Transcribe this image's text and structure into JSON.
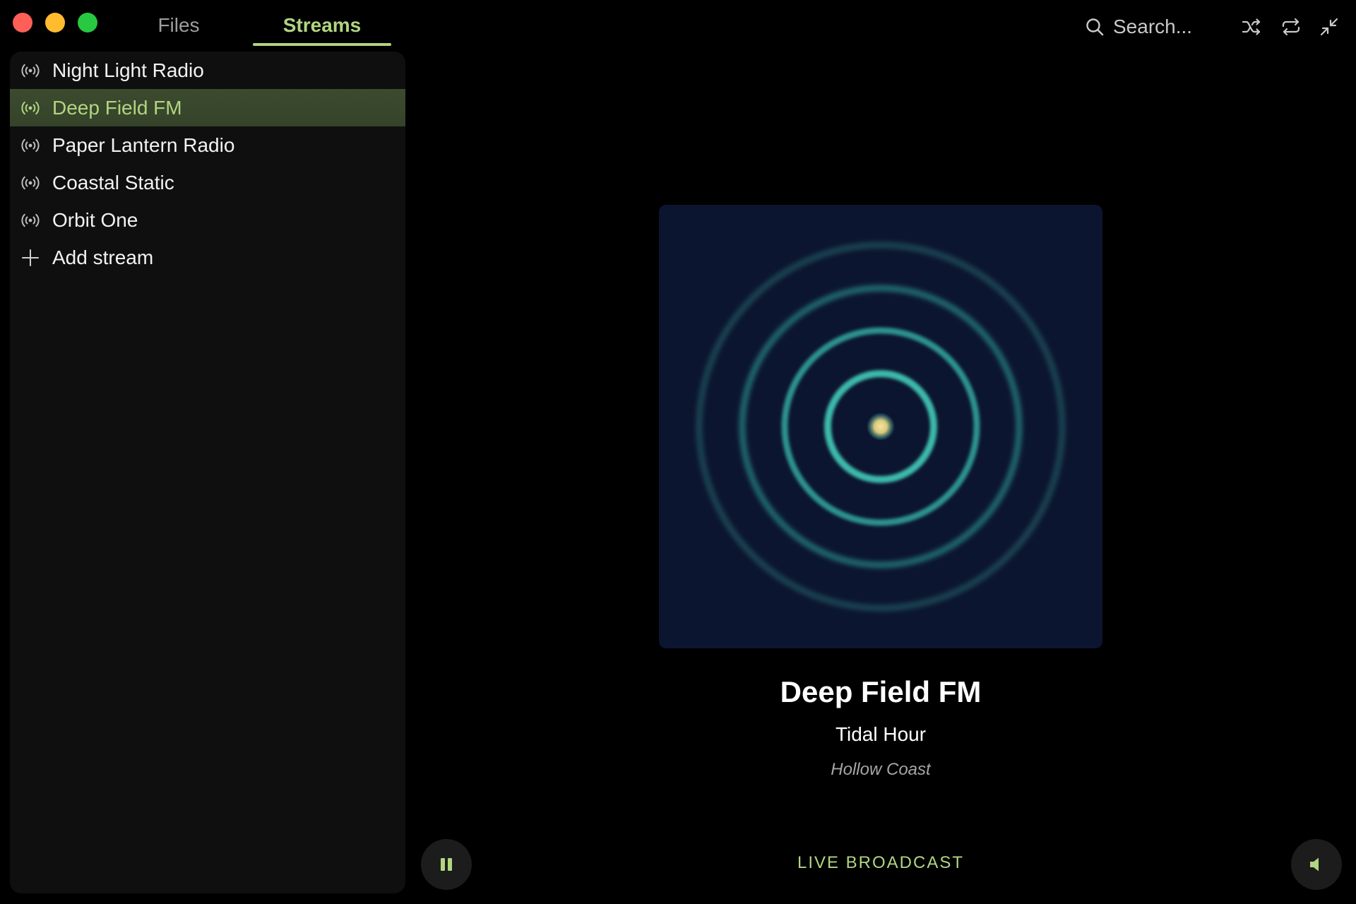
{
  "window": {
    "tabs": [
      {
        "label": "Files",
        "active": false
      },
      {
        "label": "Streams",
        "active": true
      }
    ],
    "search": {
      "placeholder": "Search..."
    },
    "icons": {
      "search": "search-icon",
      "shuffle": "shuffle-icon",
      "repeat": "repeat-icon",
      "minimize": "minimize-icon"
    }
  },
  "sidebar": {
    "streams": [
      {
        "label": "Night Light Radio",
        "icon": "broadcast-icon",
        "active": false
      },
      {
        "label": "Deep Field FM",
        "icon": "broadcast-icon",
        "active": true
      },
      {
        "label": "Paper Lantern Radio",
        "icon": "broadcast-icon",
        "active": false
      },
      {
        "label": "Coastal Static",
        "icon": "broadcast-icon",
        "active": false
      },
      {
        "label": "Orbit One",
        "icon": "broadcast-icon",
        "active": false
      }
    ],
    "add": {
      "label": "Add stream",
      "icon": "plus-icon"
    }
  },
  "now_playing": {
    "station": "Deep Field FM",
    "track": "Tidal Hour",
    "artist": "Hollow Coast",
    "status": "LIVE BROADCAST"
  },
  "controls": {
    "pause_icon": "pause-icon",
    "volume_icon": "volume-icon"
  },
  "colors": {
    "accent": "#b1d581",
    "artwork_bg": "#0c1530",
    "rings": "#3fc2b1",
    "core": "#f0d68a"
  }
}
